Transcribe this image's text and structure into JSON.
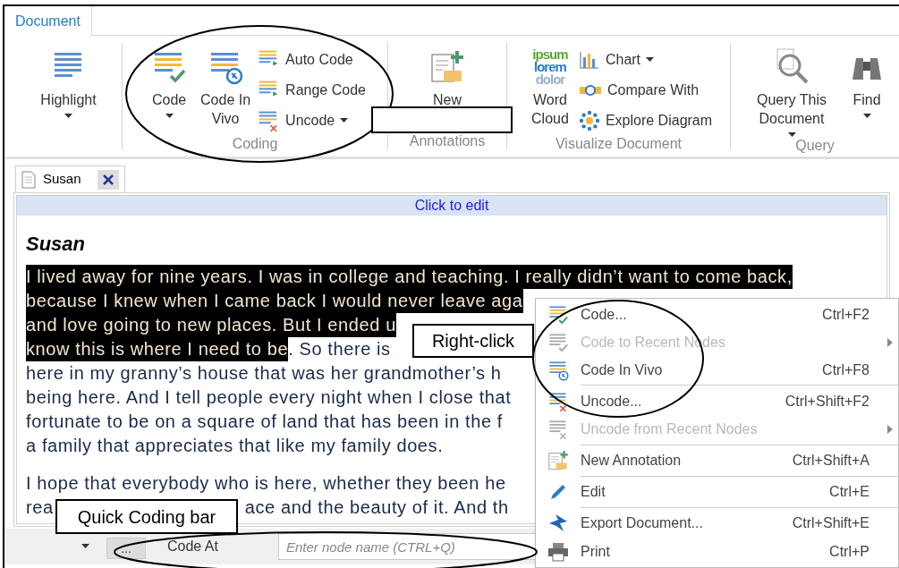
{
  "ribbon": {
    "tab": {
      "label": "Document",
      "selected": true
    },
    "groups": [
      {
        "items": [
          {
            "kind": "large",
            "label": "Highlight",
            "dropdown": true
          }
        ]
      },
      {
        "label": "Coding",
        "items": [
          {
            "kind": "large",
            "label": "Code",
            "dropdown": true
          },
          {
            "kind": "large",
            "label": "Code In Vivo",
            "dropdown": false
          },
          {
            "kind": "small",
            "label": "Auto Code",
            "dropdown": false
          },
          {
            "kind": "small",
            "label": "Range Code",
            "dropdown": false
          },
          {
            "kind": "small",
            "label": "Uncode",
            "dropdown": true
          }
        ]
      },
      {
        "label": "Annotations",
        "items": [
          {
            "kind": "large",
            "label": "New",
            "dropdown": false
          }
        ]
      },
      {
        "label": "Visualize Document",
        "items": [
          {
            "kind": "large",
            "label": "Word Cloud",
            "dropdown": false,
            "icon_words": [
              "ipsum",
              "lorem",
              "dolor"
            ]
          },
          {
            "kind": "small",
            "label": "Chart",
            "dropdown": true
          },
          {
            "kind": "small",
            "label": "Compare With",
            "dropdown": false
          },
          {
            "kind": "small",
            "label": "Explore Diagram",
            "dropdown": false
          }
        ]
      },
      {
        "label": "Query",
        "items": [
          {
            "kind": "large",
            "label": "Query This Document",
            "dropdown": true
          },
          {
            "kind": "large",
            "label": "Find",
            "dropdown": true
          }
        ]
      }
    ]
  },
  "document_tabs": [
    {
      "label": "Susan",
      "selected": true,
      "closable": true
    }
  ],
  "edit_bar": "Click to edit",
  "document": {
    "title": "Susan",
    "paragraphs": [
      [
        [
          {
            "text": "I lived away for nine years. I was in college and teaching. I really didn’t want to come back,",
            "highlighted": true
          }
        ],
        [
          {
            "text": "because I knew when I came back I would never leave aga",
            "highlighted": true
          }
        ],
        [
          {
            "text": "and love going to new places. But I ended u",
            "highlighted": true
          }
        ],
        [
          {
            "text": "know this is where I need to be",
            "highlighted": true
          },
          {
            "text": ". So there is",
            "highlighted": false
          }
        ],
        [
          {
            "text": "here in my granny’s house that was her grandmother’s h",
            "highlighted": false
          }
        ],
        [
          {
            "text": "being here. And I tell people every night when I close that",
            "highlighted": false
          }
        ],
        [
          {
            "text": "fortunate to be on a square of land that has been in the f",
            "highlighted": false
          }
        ],
        [
          {
            "text": "a family that appreciates that like my family does.",
            "highlighted": false
          }
        ]
      ],
      [
        [
          {
            "text": "I hope that everybody who is here, whether they been he",
            "highlighted": false
          }
        ],
        [
          {
            "text": "rea",
            "highlighted": false
          },
          {
            "text": "ace and the beauty of it. And th",
            "highlighted": false
          }
        ]
      ]
    ]
  },
  "quick_coding_bar": {
    "button": "...",
    "label": "Code At",
    "placeholder": "Enter node name (CTRL+Q)"
  },
  "context_menu": [
    {
      "kind": "item",
      "label": "Code...",
      "shortcut": "Ctrl+F2",
      "disabled": false,
      "submenu": false
    },
    {
      "kind": "item",
      "label": "Code to Recent Nodes",
      "disabled": true,
      "submenu": true
    },
    {
      "kind": "item",
      "label": "Code In Vivo",
      "shortcut": "Ctrl+F8",
      "disabled": false,
      "submenu": false
    },
    {
      "kind": "separator"
    },
    {
      "kind": "item",
      "label": "Uncode...",
      "shortcut": "Ctrl+Shift+F2",
      "disabled": false,
      "submenu": false
    },
    {
      "kind": "item",
      "label": "Uncode from Recent Nodes",
      "disabled": true,
      "submenu": true
    },
    {
      "kind": "separator"
    },
    {
      "kind": "item",
      "label": "New Annotation",
      "shortcut": "Ctrl+Shift+A",
      "disabled": false,
      "submenu": false
    },
    {
      "kind": "separator"
    },
    {
      "kind": "item",
      "label": "Edit",
      "shortcut": "Ctrl+E",
      "disabled": false,
      "submenu": false
    },
    {
      "kind": "separator"
    },
    {
      "kind": "item",
      "label": "Export Document...",
      "shortcut": "Ctrl+Shift+E",
      "disabled": false,
      "submenu": false
    },
    {
      "kind": "item",
      "label": "Print",
      "shortcut": "Ctrl+P",
      "disabled": false,
      "submenu": false
    }
  ],
  "callouts": [
    {
      "text": "Right-click"
    },
    {
      "text": "Quick Coding bar"
    }
  ]
}
